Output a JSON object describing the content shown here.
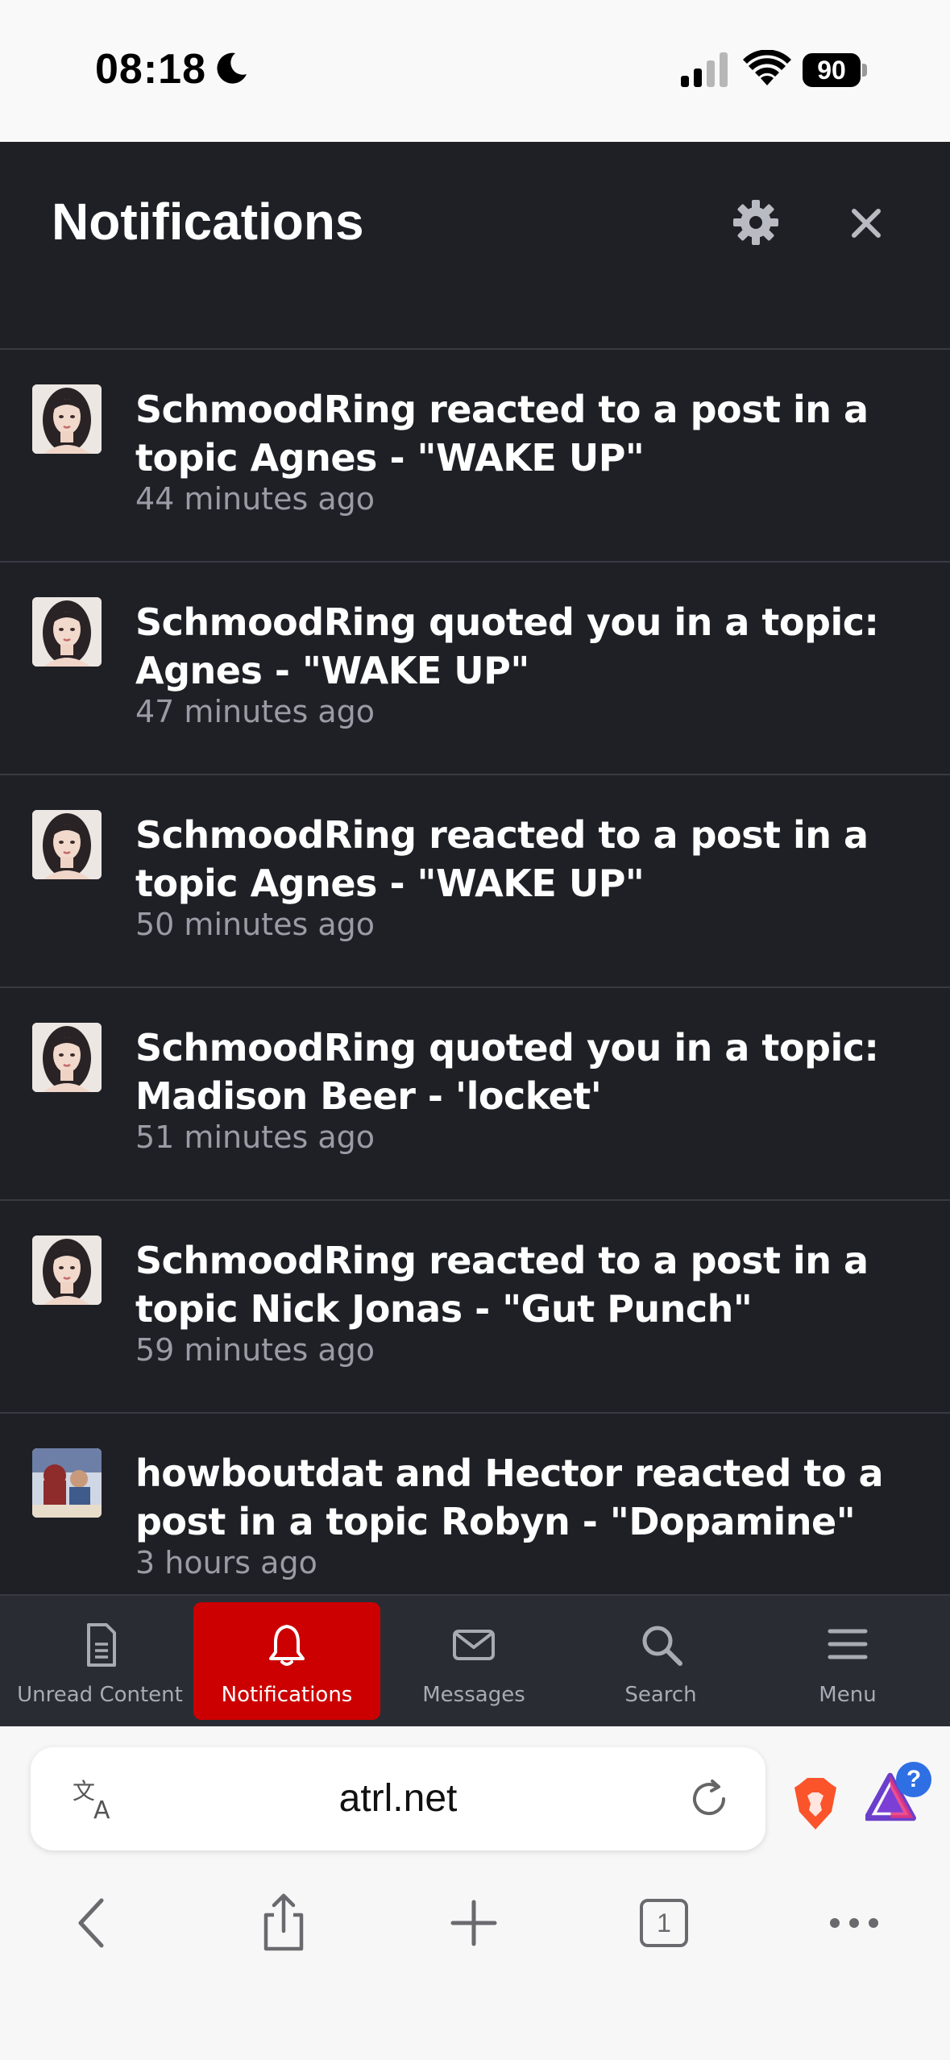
{
  "status_bar": {
    "time": "08:18",
    "battery": "90"
  },
  "panel": {
    "title": "Notifications",
    "notifications": [
      {
        "text": "SchmoodRing reacted to a post in a topic Agnes - \"WAKE UP\"",
        "time": "44 minutes ago",
        "avatar": "schmoodring"
      },
      {
        "text": "SchmoodRing quoted you in a topic: Agnes - \"WAKE UP\"",
        "time": "47 minutes ago",
        "avatar": "schmoodring"
      },
      {
        "text": "SchmoodRing reacted to a post in a topic Agnes - \"WAKE UP\"",
        "time": "50 minutes ago",
        "avatar": "schmoodring"
      },
      {
        "text": "SchmoodRing quoted you in a topic: Madison Beer - 'locket'",
        "time": "51 minutes ago",
        "avatar": "schmoodring"
      },
      {
        "text": "SchmoodRing reacted to a post in a topic Nick Jonas - \"Gut Punch\"",
        "time": "59 minutes ago",
        "avatar": "schmoodring"
      },
      {
        "text": "howboutdat and Hector reacted to a post in a topic Robyn - \"Dopamine\"",
        "time": "3 hours ago",
        "avatar": "howboutdat"
      }
    ]
  },
  "tabbar": {
    "tabs": [
      {
        "label": "Unread Content",
        "icon": "document-icon",
        "active": false
      },
      {
        "label": "Notifications",
        "icon": "bell-icon",
        "active": true
      },
      {
        "label": "Messages",
        "icon": "envelope-icon",
        "active": false
      },
      {
        "label": "Search",
        "icon": "search-icon",
        "active": false
      },
      {
        "label": "Menu",
        "icon": "hamburger-icon",
        "active": false
      }
    ]
  },
  "browser": {
    "url": "atrl.net",
    "tab_count": "1",
    "rewards_badge": "?"
  },
  "colors": {
    "panel_bg": "#1f2026",
    "active_tab": "#cc0000",
    "brave_orange": "#fb542b"
  }
}
